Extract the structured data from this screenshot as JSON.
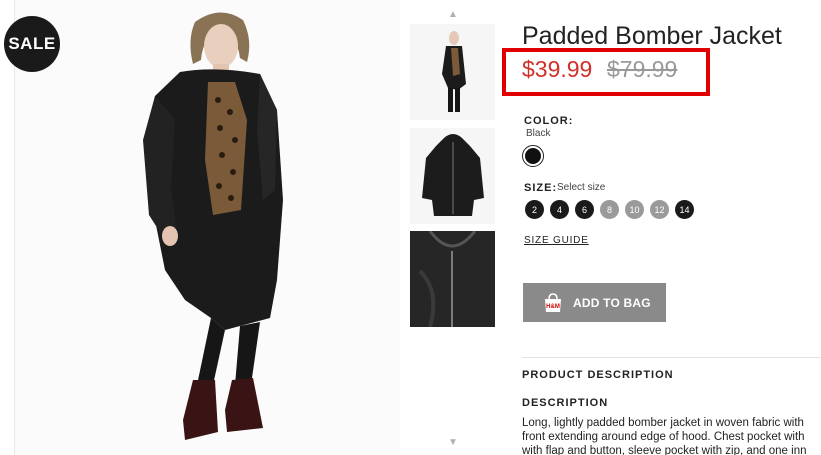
{
  "sale_badge": "SALE",
  "product": {
    "title": "Padded Bomber Jacket",
    "sale_price": "$39.99",
    "original_price": "$79.99"
  },
  "color": {
    "label": "COLOR:",
    "selected": "Black",
    "swatch_color": "#111111"
  },
  "size": {
    "label": "SIZE:",
    "hint": "Select size",
    "options": [
      {
        "label": "2",
        "available": true
      },
      {
        "label": "4",
        "available": true
      },
      {
        "label": "6",
        "available": true
      },
      {
        "label": "8",
        "available": false
      },
      {
        "label": "10",
        "available": false
      },
      {
        "label": "12",
        "available": false
      },
      {
        "label": "14",
        "available": true
      }
    ],
    "guide_link": "SIZE GUIDE"
  },
  "add_to_bag": "ADD TO BAG",
  "product_description_heading": "PRODUCT DESCRIPTION",
  "description": {
    "heading": "DESCRIPTION",
    "lines": [
      "Long, lightly padded bomber jacket in woven fabric with",
      "front extending around edge of hood. Chest pocket with",
      "with flap and button, sleeve pocket with zip, and one inn"
    ]
  },
  "colors": {
    "highlight": "#e00000",
    "sale_price": "#d0302a",
    "button": "#8a8a8a"
  }
}
